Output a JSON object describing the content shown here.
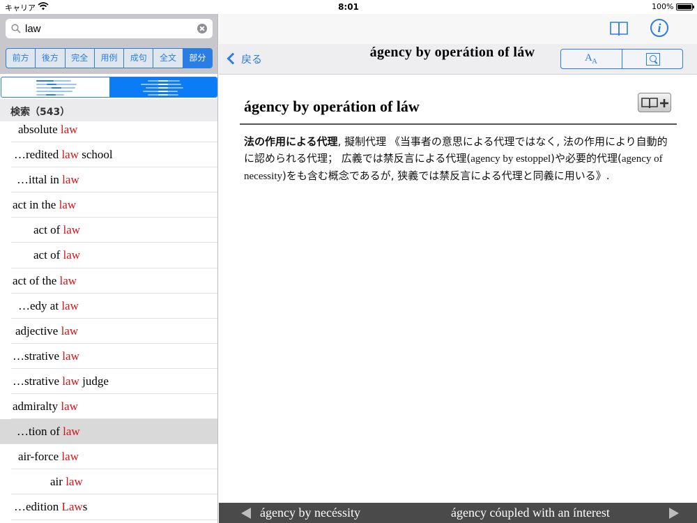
{
  "status": {
    "carrier": "キャリア",
    "time": "8:01",
    "battery": "100%"
  },
  "search": {
    "query": "law"
  },
  "modes": [
    "前方",
    "後方",
    "完全",
    "用例",
    "成句",
    "全文",
    "部分"
  ],
  "active_mode": "部分",
  "results": {
    "header": "検索（543）",
    "items": [
      {
        "pre": "absolute ",
        "hit": "law",
        "post": "",
        "indent": 10
      },
      {
        "pre": "…redited ",
        "hit": "law",
        "post": " school",
        "indent": 4
      },
      {
        "pre": "…ittal in ",
        "hit": "law",
        "post": "",
        "indent": 8
      },
      {
        "pre": "act in the ",
        "hit": "law",
        "post": "",
        "indent": 2
      },
      {
        "pre": "act of ",
        "hit": "law",
        "post": "",
        "indent": 32
      },
      {
        "pre": "act of ",
        "hit": "law",
        "post": "",
        "indent": 32
      },
      {
        "pre": "act of the ",
        "hit": "law",
        "post": "",
        "indent": 2
      },
      {
        "pre": "…edy at ",
        "hit": "law",
        "post": "",
        "indent": 10
      },
      {
        "pre": "adjective ",
        "hit": "law",
        "post": "",
        "indent": 6
      },
      {
        "pre": "…strative ",
        "hit": "law",
        "post": "",
        "indent": 2
      },
      {
        "pre": "…strative ",
        "hit": "law",
        "post": " judge",
        "indent": 2
      },
      {
        "pre": "admiralty ",
        "hit": "law",
        "post": "",
        "indent": 2
      },
      {
        "pre": "…tion of ",
        "hit": "law",
        "post": "",
        "indent": 8,
        "selected": true
      },
      {
        "pre": "air-force ",
        "hit": "law",
        "post": "",
        "indent": 10
      },
      {
        "pre": "air ",
        "hit": "law",
        "post": "",
        "indent": 56
      },
      {
        "pre": "…edition ",
        "hit": "Law",
        "post": "s",
        "indent": 4
      }
    ]
  },
  "detail": {
    "back_label": "戻る",
    "title": "ágency by operátion of láw",
    "headword": "ágency by operátion of láw",
    "body_bold": "法の作用による代理",
    "body_rest_1": ", 擬制代理 《当事者の意思による代理ではなく, 法の作用により自動的に認められる代理； 広義では禁反言による代理(",
    "body_en_1": "agency by estoppel",
    "body_rest_2": ")や必要的代理(",
    "body_en_2": "agency of necessity",
    "body_rest_3": ")をも含む概念であるが, 狭義では禁反言による代理と同義に用いる》."
  },
  "nav": {
    "prev": "ágency by necéssity",
    "next": "ágency cóupled with an ínterest"
  },
  "colors": {
    "accent": "#2a7ee3",
    "highlight": "#d6131b",
    "bottombar": "#4a4a4a"
  }
}
